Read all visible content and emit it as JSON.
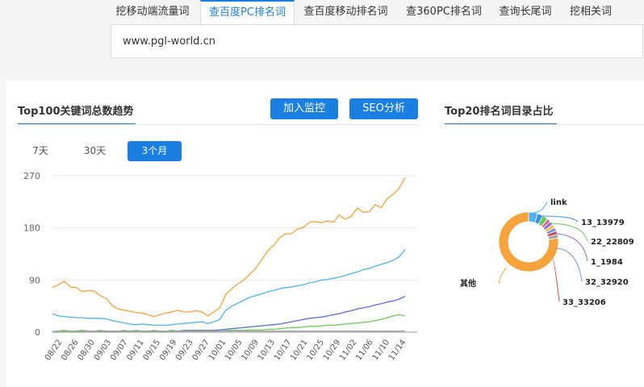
{
  "tabs": [
    {
      "label": "挖移动端流量词",
      "active": false
    },
    {
      "label": "查百度PC排名词",
      "active": true
    },
    {
      "label": "查百度移动排名词",
      "active": false
    },
    {
      "label": "查360PC排名词",
      "active": false
    },
    {
      "label": "查询长尾词",
      "active": false
    },
    {
      "label": "挖相关词",
      "active": false
    }
  ],
  "search": {
    "value": "www.pgl-world.cn"
  },
  "trend": {
    "title": "Top100关键词总数趋势",
    "add_monitor_label": "加入监控",
    "seo_label": "SEO分析",
    "ranges": [
      "7天",
      "30天",
      "3个月"
    ],
    "active_range": "3个月"
  },
  "donut": {
    "title": "Top20排名词目录占比",
    "labels": [
      "link",
      "13_13979",
      "22_22809",
      "1_1984",
      "32_32920",
      "33_33206",
      "其他"
    ]
  },
  "colors": {
    "accent": "#1a7fe0",
    "orange": "#f5a33a",
    "blue": "#4fb3ea",
    "green": "#6ccd54",
    "gray": "#a0a0a0"
  },
  "chart_data": [
    {
      "type": "line",
      "title": "",
      "ylim": [
        0,
        270
      ],
      "yticks": [
        0,
        90,
        180,
        270
      ],
      "xtick_labels": [
        "08/22",
        "08/26",
        "08/30",
        "09/03",
        "09/07",
        "09/11",
        "09/15",
        "09/19",
        "09/23",
        "09/27",
        "10/01",
        "10/05",
        "10/09",
        "10/13",
        "10/17",
        "10/21",
        "10/25",
        "10/29",
        "11/02",
        "11/06",
        "11/10",
        "11/14"
      ],
      "series": [
        {
          "color": "#f5a33a",
          "values": [
            77,
            82,
            88,
            78,
            77,
            70,
            72,
            71,
            63,
            58,
            46,
            40,
            38,
            36,
            34,
            33,
            30,
            27,
            30,
            33,
            35,
            38,
            35,
            35,
            37,
            35,
            28,
            35,
            42,
            65,
            75,
            83,
            90,
            100,
            110,
            125,
            140,
            150,
            163,
            170,
            170,
            178,
            181,
            190,
            191,
            189,
            192,
            190,
            202,
            195,
            200,
            214,
            207,
            208,
            220,
            215,
            230,
            238,
            248,
            267
          ]
        },
        {
          "color": "#4fb3ea",
          "values": [
            32,
            28,
            27,
            26,
            25,
            25,
            24,
            24,
            24,
            23,
            20,
            18,
            16,
            14,
            13,
            14,
            13,
            12,
            12,
            12,
            13,
            14,
            15,
            16,
            17,
            18,
            15,
            18,
            22,
            38,
            45,
            50,
            55,
            60,
            63,
            66,
            70,
            72,
            75,
            77,
            78,
            80,
            82,
            85,
            87,
            90,
            91,
            93,
            95,
            98,
            101,
            104,
            108,
            110,
            114,
            117,
            120,
            124,
            130,
            143
          ]
        },
        {
          "color": "#5b6cd6",
          "values": [
            1,
            1,
            1,
            1,
            2,
            2,
            2,
            2,
            2,
            2,
            2,
            2,
            2,
            2,
            2,
            2,
            2,
            2,
            2,
            2,
            2,
            2,
            3,
            3,
            3,
            3,
            3,
            3,
            4,
            5,
            6,
            7,
            8,
            9,
            10,
            11,
            12,
            13,
            14,
            16,
            18,
            20,
            22,
            24,
            25,
            26,
            28,
            30,
            32,
            35,
            37,
            40,
            42,
            44,
            47,
            49,
            52,
            54,
            57,
            62
          ]
        },
        {
          "color": "#6ccd54",
          "values": [
            1,
            1,
            1,
            1,
            1,
            2,
            2,
            2,
            2,
            2,
            2,
            2,
            2,
            2,
            2,
            2,
            2,
            2,
            2,
            2,
            2,
            2,
            2,
            2,
            2,
            2,
            2,
            2,
            2,
            3,
            3,
            3,
            3,
            4,
            4,
            4,
            5,
            5,
            6,
            7,
            8,
            8,
            9,
            10,
            10,
            11,
            12,
            12,
            13,
            14,
            15,
            16,
            17,
            18,
            20,
            22,
            25,
            28,
            30,
            28
          ]
        },
        {
          "color": "#a0a0a0",
          "values": [
            1,
            2,
            3,
            2,
            2,
            3,
            2,
            2,
            3,
            2,
            2,
            2,
            3,
            2,
            3,
            2,
            2,
            3,
            2,
            2,
            3,
            2,
            2,
            2,
            2,
            2,
            2,
            2,
            2,
            2,
            2,
            2,
            2,
            2,
            2,
            2,
            2,
            2,
            2,
            2,
            2,
            2,
            2,
            2,
            2,
            2,
            2,
            2,
            2,
            2,
            2,
            2,
            2,
            2,
            2,
            2,
            2,
            2,
            2,
            2
          ]
        }
      ]
    },
    {
      "type": "pie",
      "title": "",
      "slices": [
        {
          "label": "link",
          "value": 5,
          "color": "#4fb3ea"
        },
        {
          "label": "13_13979",
          "value": 3,
          "color": "#3a8ee6"
        },
        {
          "label": "22_22809",
          "value": 3,
          "color": "#6ccd54"
        },
        {
          "label": "",
          "value": 2,
          "color": "#e06aa0"
        },
        {
          "label": "1_1984",
          "value": 2,
          "color": "#8e6ce0"
        },
        {
          "label": "",
          "value": 2,
          "color": "#f0c040"
        },
        {
          "label": "32_32920",
          "value": 2,
          "color": "#7a8fe0"
        },
        {
          "label": "33_33206",
          "value": 2,
          "color": "#d04a4a"
        },
        {
          "label": "",
          "value": 2,
          "color": "#a0a0a0"
        },
        {
          "label": "其他",
          "value": 77,
          "color": "#f5a33a"
        }
      ]
    }
  ]
}
